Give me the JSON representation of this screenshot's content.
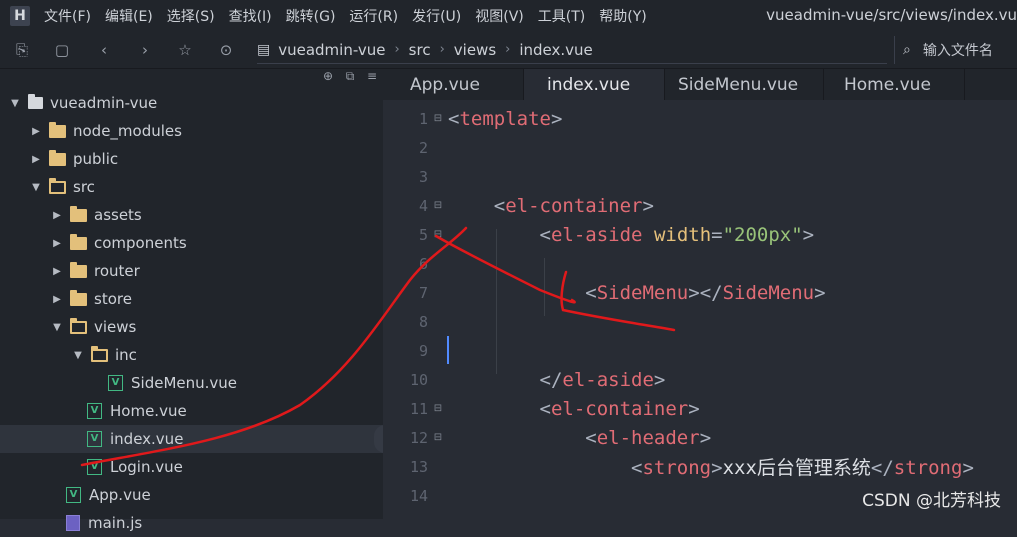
{
  "app": {
    "logo_letter": "H",
    "window_title": "vueadmin-vue/src/views/index.vu",
    "menu": [
      "文件(F)",
      "编辑(E)",
      "选择(S)",
      "查找(I)",
      "跳转(G)",
      "运行(R)",
      "发行(U)",
      "视图(V)",
      "工具(T)",
      "帮助(Y)"
    ]
  },
  "toolbar": {
    "icons": [
      "new-file-icon",
      "save-icon",
      "back-icon",
      "forward-icon",
      "star-icon",
      "run-icon"
    ],
    "breadcrumb": [
      "vueadmin-vue",
      "src",
      "views",
      "index.vue"
    ],
    "file_search_placeholder": "输入文件名"
  },
  "sidebar": {
    "actions": [
      "⊕",
      "⧉",
      "≡"
    ],
    "tree": [
      {
        "label": "vueadmin-vue",
        "type": "root",
        "expanded": true
      },
      {
        "label": "node_modules",
        "type": "folder",
        "expanded": false
      },
      {
        "label": "public",
        "type": "folder",
        "expanded": false
      },
      {
        "label": "src",
        "type": "folder",
        "expanded": true
      },
      {
        "label": "assets",
        "type": "folder",
        "expanded": false
      },
      {
        "label": "components",
        "type": "folder",
        "expanded": false
      },
      {
        "label": "router",
        "type": "folder",
        "expanded": false
      },
      {
        "label": "store",
        "type": "folder",
        "expanded": false
      },
      {
        "label": "views",
        "type": "folder",
        "expanded": true
      },
      {
        "label": "inc",
        "type": "folder",
        "expanded": true
      },
      {
        "label": "SideMenu.vue",
        "type": "vue"
      },
      {
        "label": "Home.vue",
        "type": "vue"
      },
      {
        "label": "index.vue",
        "type": "vue",
        "selected": true
      },
      {
        "label": "Login.vue",
        "type": "vue"
      },
      {
        "label": "App.vue",
        "type": "vue"
      },
      {
        "label": "main.js",
        "type": "js"
      }
    ]
  },
  "editor": {
    "tabs": [
      {
        "label": "App.vue",
        "active": false
      },
      {
        "label": "index.vue",
        "active": true
      },
      {
        "label": "SideMenu.vue",
        "active": false
      },
      {
        "label": "Home.vue",
        "active": false
      }
    ],
    "lines": [
      {
        "n": "1",
        "fold": true,
        "tokens": [
          [
            "br",
            "<"
          ],
          [
            "tag",
            "template"
          ],
          [
            "br",
            ">"
          ]
        ]
      },
      {
        "n": "2",
        "fold": false,
        "tokens": []
      },
      {
        "n": "3",
        "fold": false,
        "tokens": []
      },
      {
        "n": "4",
        "fold": true,
        "tokens": [
          [
            "txt",
            "    "
          ],
          [
            "br",
            "<"
          ],
          [
            "tag",
            "el-container"
          ],
          [
            "br",
            ">"
          ]
        ]
      },
      {
        "n": "5",
        "fold": true,
        "tokens": [
          [
            "txt",
            "        "
          ],
          [
            "br",
            "<"
          ],
          [
            "tag",
            "el-aside"
          ],
          [
            "txt",
            " "
          ],
          [
            "attr",
            "width"
          ],
          [
            "br",
            "="
          ],
          [
            "str",
            "\"200px\""
          ],
          [
            "br",
            ">"
          ]
        ]
      },
      {
        "n": "6",
        "fold": false,
        "tokens": []
      },
      {
        "n": "7",
        "fold": false,
        "tokens": [
          [
            "txt",
            "            "
          ],
          [
            "br",
            "<"
          ],
          [
            "tag",
            "SideMenu"
          ],
          [
            "br",
            "></"
          ],
          [
            "tag",
            "SideMenu"
          ],
          [
            "br",
            ">"
          ]
        ]
      },
      {
        "n": "8",
        "fold": false,
        "tokens": []
      },
      {
        "n": "9",
        "fold": false,
        "tokens": []
      },
      {
        "n": "10",
        "fold": false,
        "tokens": [
          [
            "txt",
            "        "
          ],
          [
            "br",
            "</"
          ],
          [
            "tag",
            "el-aside"
          ],
          [
            "br",
            ">"
          ]
        ]
      },
      {
        "n": "11",
        "fold": true,
        "tokens": [
          [
            "txt",
            "        "
          ],
          [
            "br",
            "<"
          ],
          [
            "tag",
            "el-container"
          ],
          [
            "br",
            ">"
          ]
        ]
      },
      {
        "n": "12",
        "fold": true,
        "tokens": [
          [
            "txt",
            "            "
          ],
          [
            "br",
            "<"
          ],
          [
            "tag",
            "el-header"
          ],
          [
            "br",
            ">"
          ]
        ]
      },
      {
        "n": "13",
        "fold": false,
        "tokens": [
          [
            "txt",
            "                "
          ],
          [
            "br",
            "<"
          ],
          [
            "tag",
            "strong"
          ],
          [
            "br",
            ">"
          ],
          [
            "txt",
            "xxx后台管理系统"
          ],
          [
            "br",
            "</"
          ],
          [
            "tag",
            "strong"
          ],
          [
            "br",
            ">"
          ]
        ]
      },
      {
        "n": "14",
        "fold": false,
        "tokens": []
      }
    ]
  },
  "watermark": "CSDN @北芳科技",
  "colors": {
    "background": "#282c34",
    "sidebar": "#21252b",
    "tag": "#e06c75",
    "attr": "#e5c07b",
    "string": "#98c379",
    "annotation": "#e0191b"
  }
}
